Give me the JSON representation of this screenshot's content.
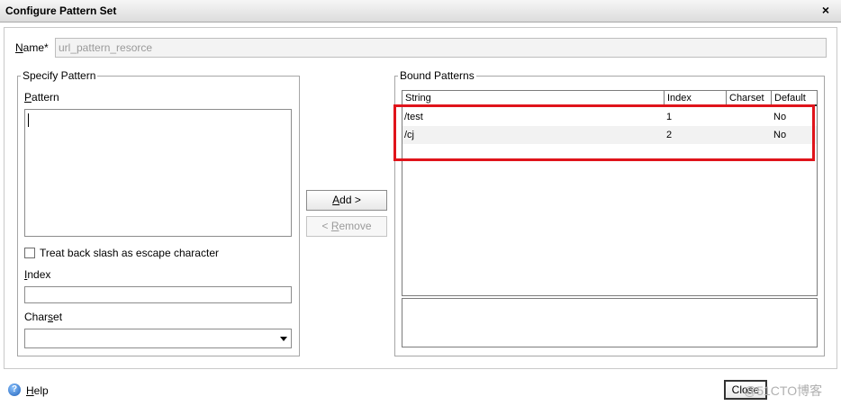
{
  "window": {
    "title": "Configure Pattern Set",
    "close_glyph": "×"
  },
  "name_field": {
    "label_first": "N",
    "label_rest": "ame*",
    "value": "url_pattern_resorce"
  },
  "specify_pattern": {
    "legend": "Specify Pattern",
    "pattern_label_first": "P",
    "pattern_label_rest": "attern",
    "escape_checkbox_label": "Treat back slash as escape character",
    "index_label_first": "I",
    "index_label_rest": "ndex",
    "charset_label_first": "Char",
    "charset_label_mid": "s",
    "charset_label_rest": "et",
    "charset_value": ""
  },
  "buttons": {
    "add_first": "A",
    "add_rest": "dd >",
    "remove_prefix": "< ",
    "remove_first": "R",
    "remove_rest": "emove"
  },
  "bound_patterns": {
    "legend": "Bound Patterns",
    "columns": [
      "String",
      "Index",
      "Charset",
      "Default"
    ],
    "rows": [
      {
        "string": "/test",
        "index": "1",
        "charset": "",
        "default": "No"
      },
      {
        "string": "/cj",
        "index": "2",
        "charset": "",
        "default": "No"
      }
    ]
  },
  "footer": {
    "help_icon_glyph": "?",
    "help_first": "H",
    "help_rest": "elp",
    "close_label": "Close",
    "watermark": "@51CTO博客"
  },
  "colors": {
    "highlight_border": "#e0141b",
    "row_alt": "#f2f2f2",
    "help_icon": "#1f5fb8"
  }
}
